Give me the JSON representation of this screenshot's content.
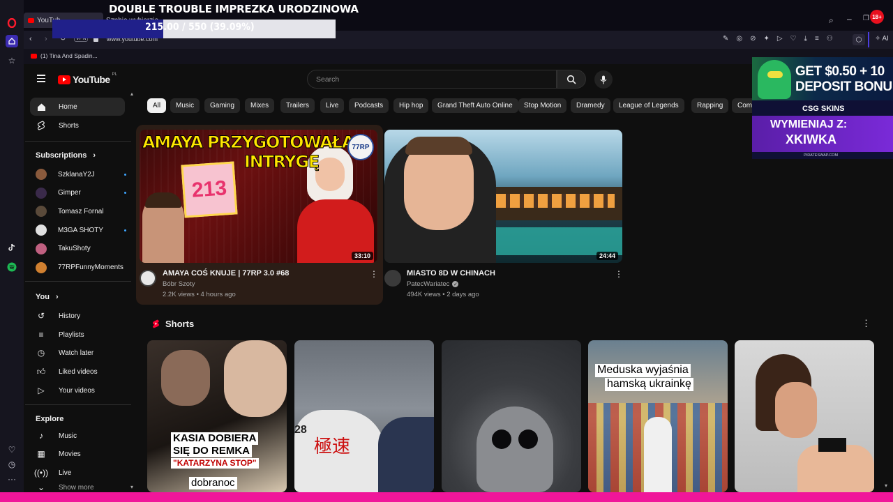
{
  "stream_overlay": {
    "title": "DOUBLE TROUBLE IMPREZKA URODZINOWA",
    "goal_text": "215.00 / 550 (39.09%)",
    "goal_fraction": 0.3909
  },
  "browser": {
    "tabs": [
      "YouTub",
      "Szpbie wybierzie"
    ],
    "vpn_badge": "VPN",
    "url": "www.youtube.com",
    "bookmark": "(1) Tina And Spadin...",
    "ai_label": "AI",
    "age_badge": "18+"
  },
  "youtube": {
    "logo_text": "YouTube",
    "country_code": "PL",
    "search_placeholder": "Search",
    "sidebar": {
      "home": "Home",
      "shorts": "Shorts",
      "subscriptions_header": "Subscriptions",
      "channels": [
        {
          "name": "SzklanaY2J",
          "color": "#8a5a3c",
          "new": true
        },
        {
          "name": "Gimper",
          "color": "#3a2a4a",
          "new": true
        },
        {
          "name": "Tomasz Fornal",
          "color": "#5a4a3a",
          "new": false
        },
        {
          "name": "M3GA SHOTY",
          "color": "#e0e0e0",
          "new": true
        },
        {
          "name": "TakuShoty",
          "color": "#c06080",
          "new": false
        },
        {
          "name": "77RPFunnyMoments",
          "color": "#d08030",
          "new": false
        }
      ],
      "you_header": "You",
      "you_items": [
        "History",
        "Playlists",
        "Watch later",
        "Liked videos",
        "Your videos"
      ],
      "explore_header": "Explore",
      "explore_items": [
        "Music",
        "Movies",
        "Live"
      ],
      "show_more": "Show more"
    },
    "chips": [
      "All",
      "Music",
      "Gaming",
      "Mixes",
      "Trailers",
      "Live",
      "Podcasts",
      "Hip hop",
      "Grand Theft Auto Online",
      "Stop Motion",
      "Dramedy",
      "League of Legends",
      "Rapping",
      "Comedy"
    ],
    "videos": [
      {
        "title": "AMAYA COŚ KNUJE | 77RP 3.0 #68",
        "channel": "Bóbr Szoty",
        "views": "2.2K views",
        "age": "4 hours ago",
        "duration": "33:10",
        "thumb_text_1": "AMAYA PRZYGOTOWAŁA",
        "thumb_text_2": "INTRYGĘ",
        "thumb_number": "213",
        "thumb_logo": "77RP"
      },
      {
        "title": "MIASTO 8D W CHINACH",
        "channel": "PatecWariatec",
        "verified": true,
        "views": "494K views",
        "age": "2 days ago",
        "duration": "24:44"
      }
    ],
    "shorts_header": "Shorts",
    "shorts": [
      {
        "caption_1": "KASIA DOBIERA",
        "caption_2": "SIĘ DO REMKA",
        "caption_3": "\"KATARZYNA STOP\"",
        "caption_4": "dobranoc"
      },
      {
        "plate_text": "28",
        "car_text": "極速"
      },
      {},
      {
        "caption_1": "Meduska wyjaśnia",
        "caption_2": "hamską ukrainkę"
      },
      {}
    ]
  },
  "ad": {
    "headline_1": "GET $0.50 + 10",
    "headline_2": "DEPOSIT BONU",
    "brand": "CSG SKINS",
    "line_1": "WYMIENIAJ Z:",
    "line_2": "XKIWKA",
    "footer": "PIRATESWAP.COM"
  }
}
